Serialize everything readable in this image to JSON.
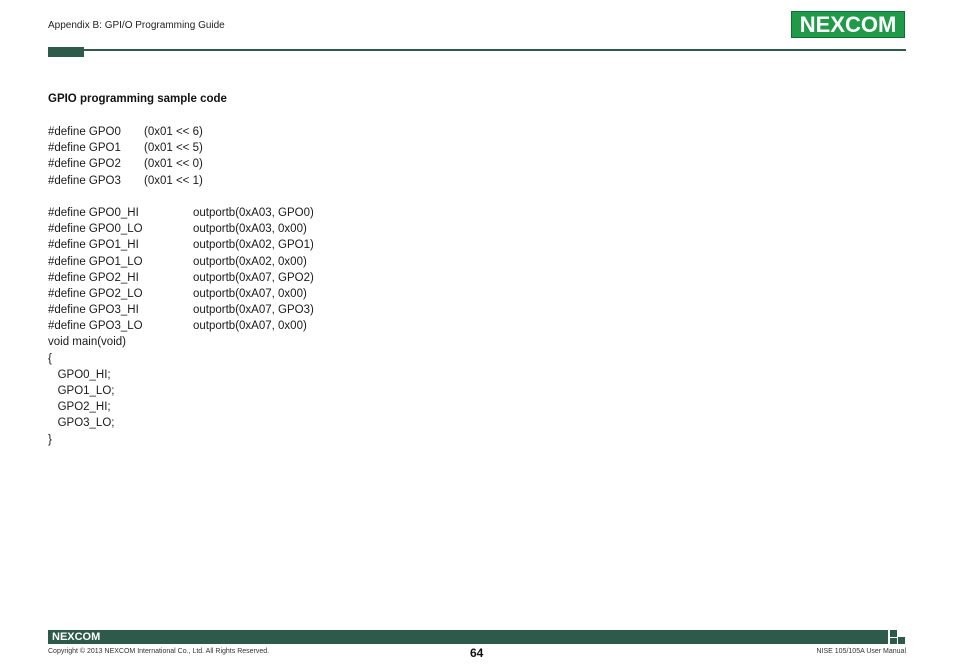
{
  "header": {
    "title": "Appendix B: GPI/O Programming Guide",
    "logo_text": "NEXCOM"
  },
  "section": {
    "heading": "GPIO programming sample code"
  },
  "code": {
    "defines_bits": [
      {
        "name": "#define GPO0",
        "value": "(0x01 << 6)"
      },
      {
        "name": "#define GPO1",
        "value": "(0x01 << 5)"
      },
      {
        "name": "#define GPO2",
        "value": "(0x01 << 0)"
      },
      {
        "name": "#define GPO3",
        "value": "(0x01 << 1)"
      }
    ],
    "defines_macros": [
      {
        "name": "#define GPO0_HI",
        "value": "outportb(0xA03, GPO0)"
      },
      {
        "name": "#define GPO0_LO",
        "value": "outportb(0xA03, 0x00)"
      },
      {
        "name": "#define GPO1_HI",
        "value": "outportb(0xA02, GPO1)"
      },
      {
        "name": "#define GPO1_LO",
        "value": "outportb(0xA02, 0x00)"
      },
      {
        "name": "#define GPO2_HI",
        "value": "outportb(0xA07, GPO2)"
      },
      {
        "name": "#define GPO2_LO",
        "value": "outportb(0xA07, 0x00)"
      },
      {
        "name": "#define GPO3_HI",
        "value": "outportb(0xA07, GPO3)"
      },
      {
        "name": "#define GPO3_LO",
        "value": "outportb(0xA07, 0x00)"
      }
    ],
    "main_signature": "void main(void)",
    "open_brace": "{",
    "body": [
      "   GPO0_HI;",
      "   GPO1_LO;",
      "   GPO2_HI;",
      "   GPO3_LO;"
    ],
    "close_brace": "}"
  },
  "footer": {
    "logo_text": "NEXCOM",
    "copyright": "Copyright © 2013 NEXCOM International Co., Ltd. All Rights Reserved.",
    "page_number": "64",
    "manual_name": "NISE 105/105A User Manual"
  },
  "colors": {
    "brand_green": "#1f9a48",
    "dark_green": "#2d5a4a"
  }
}
